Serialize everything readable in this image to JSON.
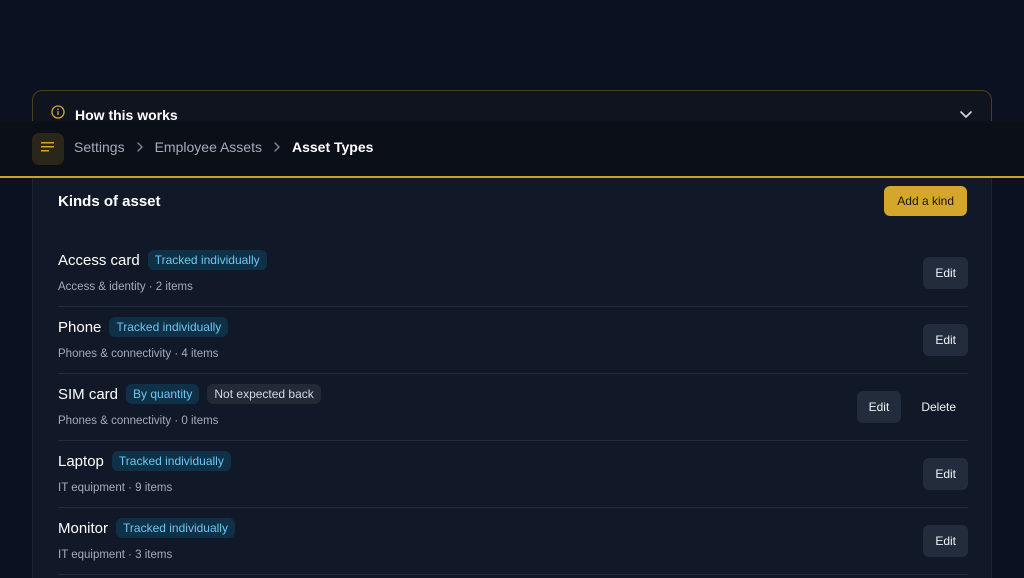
{
  "how_it_works": {
    "title": "How this works",
    "icon": "info-icon",
    "toggle_icon": "chevron-down-icon"
  },
  "topbar": {
    "menu_icon": "menu-lines-icon",
    "breadcrumbs": [
      "Settings",
      "Employee Assets",
      "Asset Types"
    ]
  },
  "panel": {
    "title": "Kinds of asset",
    "add_button": "Add a kind",
    "rows": [
      {
        "name": "Access card",
        "badges": [
          "Tracked individually"
        ],
        "meta": "Access & identity · 2 items",
        "edit": "Edit"
      },
      {
        "name": "Phone",
        "badges": [
          "Tracked individually"
        ],
        "meta": "Phones & connectivity · 4 items",
        "edit": "Edit"
      },
      {
        "name": "SIM card",
        "badges": [
          "By quantity",
          "Not expected back"
        ],
        "meta": "Phones & connectivity · 0 items",
        "edit": "Edit",
        "delete": "Delete"
      },
      {
        "name": "Laptop",
        "badges": [
          "Tracked individually"
        ],
        "meta": "IT equipment · 9 items",
        "edit": "Edit"
      },
      {
        "name": "Monitor",
        "badges": [
          "Tracked individually"
        ],
        "meta": "IT equipment · 3 items",
        "edit": "Edit"
      }
    ]
  },
  "colors": {
    "accent": "#d4a72c",
    "badge_blue_text": "#6cc6f2",
    "background": "#0b1120"
  }
}
